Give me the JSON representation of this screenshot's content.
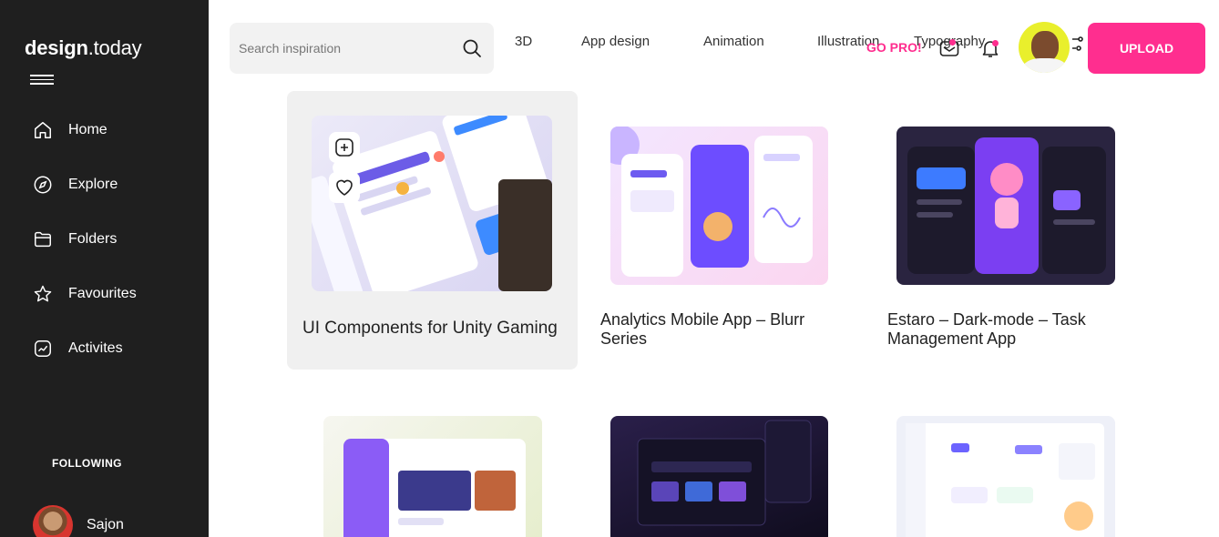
{
  "brand": {
    "name_bold": "design",
    "name_light": ".today"
  },
  "sidebar": {
    "items": [
      {
        "label": "Home",
        "icon": "home-icon"
      },
      {
        "label": "Explore",
        "icon": "compass-icon"
      },
      {
        "label": "Folders",
        "icon": "folder-icon"
      },
      {
        "label": "Favourites",
        "icon": "star-icon"
      },
      {
        "label": "Activites",
        "icon": "activity-icon"
      }
    ],
    "following_title": "FOLLOWING",
    "following": [
      {
        "name": "Sajon"
      }
    ]
  },
  "search": {
    "placeholder": "Search inspiration"
  },
  "topnav": [
    "3D",
    "App design",
    "Animation",
    "Illustration",
    "Typography"
  ],
  "header": {
    "go_pro": "GO PRO!",
    "upload": "UPLOAD"
  },
  "colors": {
    "accent": "#ff2e8f",
    "sidebar_bg": "#1f1f1f"
  },
  "cards": [
    {
      "title": "UI Components for Unity Gaming"
    },
    {
      "title": "Analytics Mobile App – Blurr Series"
    },
    {
      "title": "Estaro – Dark-mode – Task Management App"
    },
    {
      "title": ""
    },
    {
      "title": ""
    },
    {
      "title": ""
    }
  ]
}
